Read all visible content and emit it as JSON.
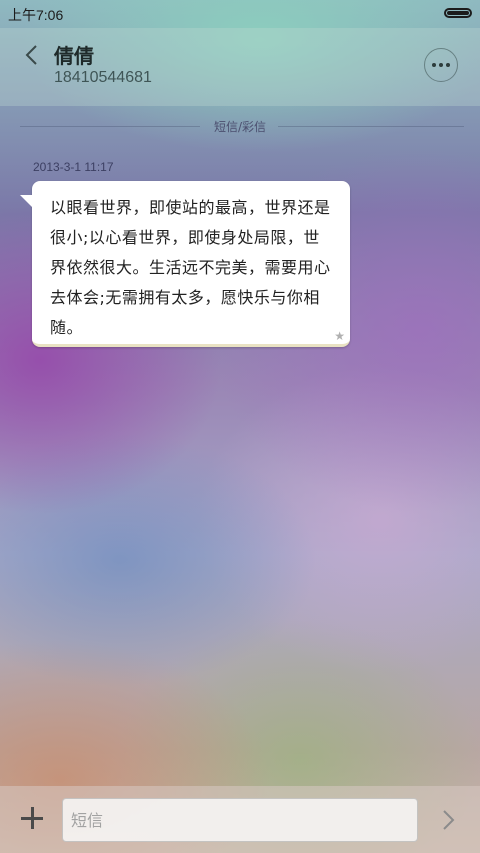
{
  "status_bar": {
    "time": "上午7:06",
    "battery_level": 1.0
  },
  "header": {
    "contact_name": "倩倩",
    "contact_number": "18410544681"
  },
  "thread": {
    "type_label": "短信/彩信",
    "messages": [
      {
        "timestamp": "2013-3-1 11:17",
        "text": "以眼看世界，即使站的最高，世界还是很小;以心看世界，即使身处局限，世界依然很大。生活远不完美，需要用心去体会;无需拥有太多，愿快乐与你相随。",
        "starred": true
      }
    ]
  },
  "composer": {
    "placeholder": "短信",
    "value": ""
  },
  "icons": {
    "back": "chevron-left-icon",
    "more": "more-dots-icon",
    "star": "star-icon",
    "add": "plus-icon",
    "send": "chevron-right-icon"
  }
}
